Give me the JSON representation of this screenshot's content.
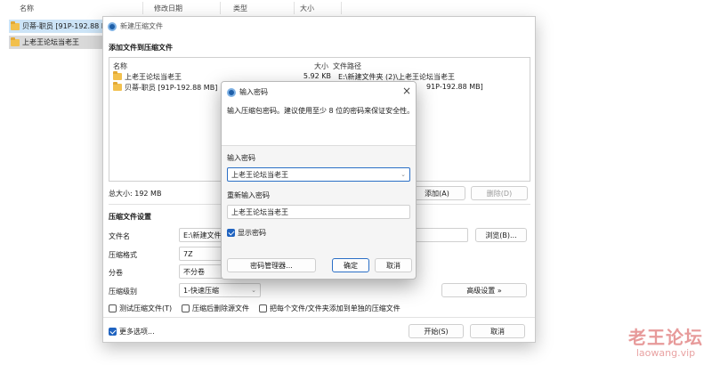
{
  "explorer": {
    "columns": [
      "名称",
      "修改日期",
      "类型",
      "大小"
    ],
    "items": [
      "贝蒂-职员 [91P-192.88 MB]",
      "上老王论坛当老王"
    ]
  },
  "window": {
    "title": "新建压缩文件",
    "add_section": "添加文件到压缩文件",
    "list_headers": {
      "name": "名称",
      "size": "大小",
      "path": "文件路径"
    },
    "files": [
      {
        "name": "上老王论坛当老王",
        "size": "5.92 KB",
        "path": "E:\\新建文件夹 (2)\\上老王论坛当老王"
      },
      {
        "name": "贝蒂-职员 [91P-192.88 MB]",
        "size": "",
        "path": "91P-192.88 MB]"
      }
    ],
    "total_size": "总大小: 192 MB",
    "add_button": "添加(A)",
    "delete_button": "删除(D)",
    "settings_section": "压缩文件设置",
    "filename_label": "文件名",
    "filename_value": "E:\\新建文件夹",
    "browse_button": "浏览(B)...",
    "format_label": "压缩格式",
    "format_value": "7Z",
    "split_label": "分卷",
    "split_value": "不分卷",
    "level_label": "压缩级别",
    "level_value": "1-快速压缩",
    "advanced_button": "高级设置 »",
    "check_test": "测试压缩文件(T)",
    "check_delete": "压缩后删除源文件",
    "check_each": "把每个文件/文件夹添加到单独的压缩文件",
    "more_options": "更多选项...",
    "start_button": "开始(S)",
    "cancel_button": "取消"
  },
  "dialog": {
    "title": "输入密码",
    "instruction": "输入压缩包密码。建议使用至少 8 位的密码来保证安全性。",
    "password_label": "输入密码",
    "password_value": "上老王论坛当老王",
    "confirm_label": "重新输入密码",
    "confirm_value": "上老王论坛当老王",
    "show_password": "显示密码",
    "manager_button": "密码管理器...",
    "ok_button": "确定",
    "cancel_button": "取消"
  },
  "watermark": {
    "line1": "老王论坛",
    "line2": "laowang.vip"
  },
  "colors": {
    "accent": "#1f63c0",
    "selection": "#cce4f7",
    "folder": "#f2c04d"
  }
}
